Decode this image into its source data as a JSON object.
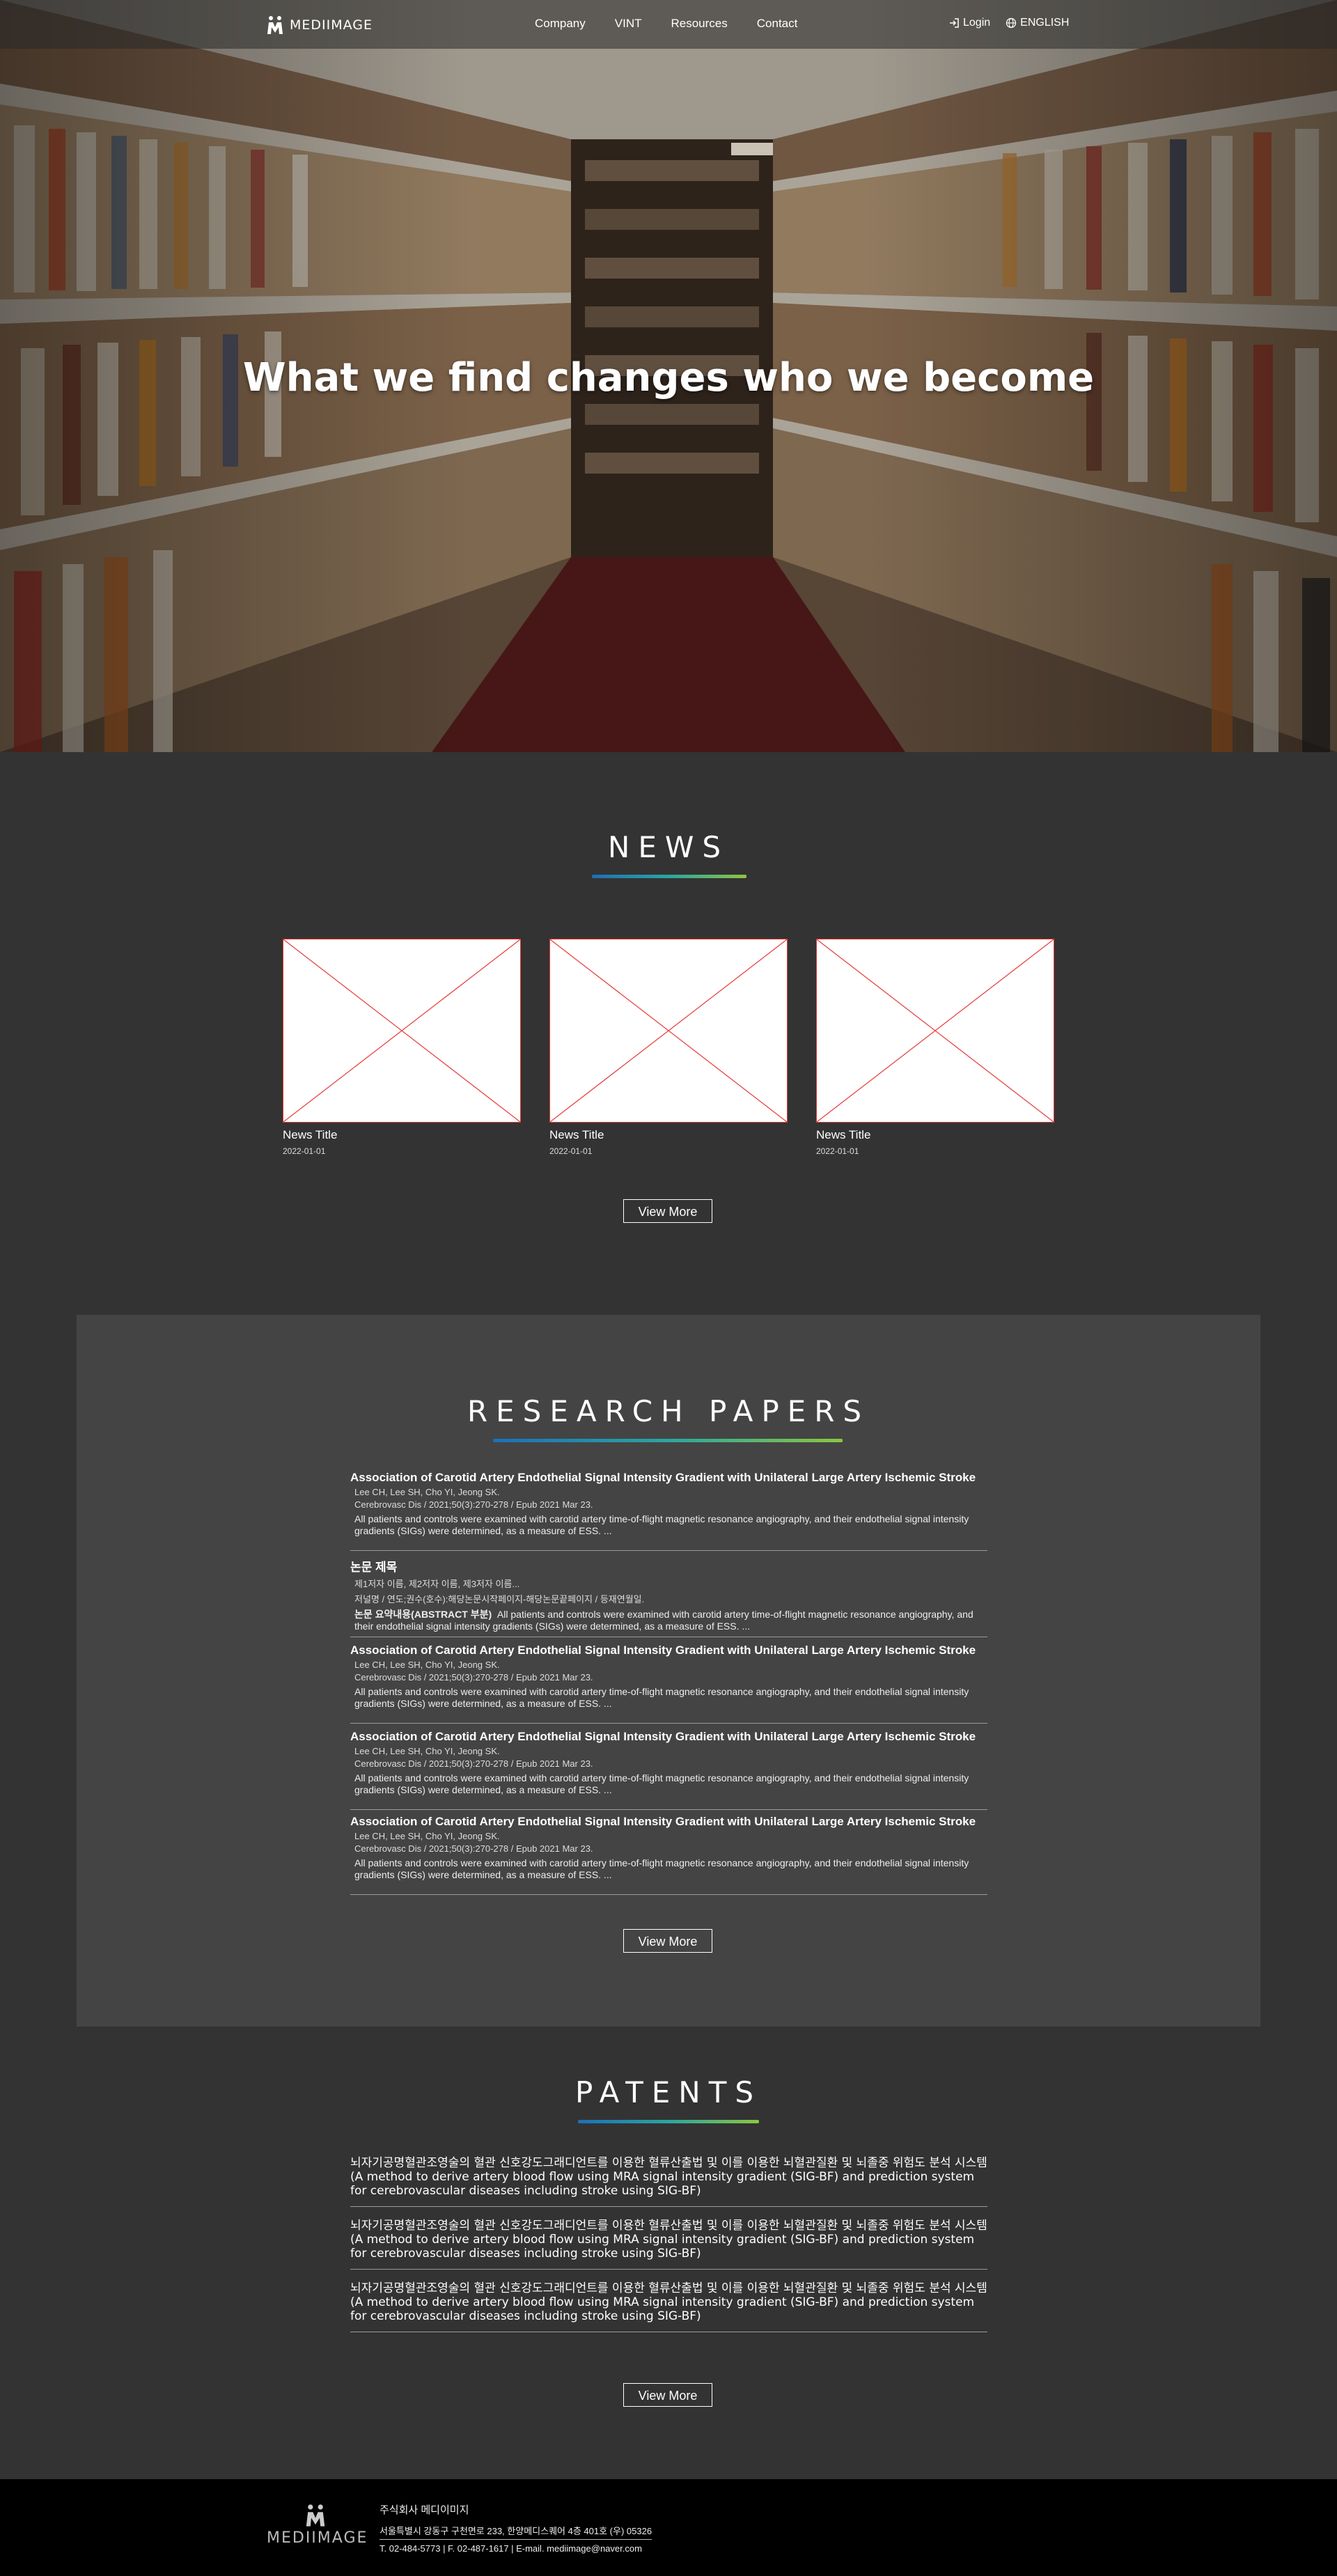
{
  "header": {
    "logo_text": "MEDIIMAGE",
    "nav": [
      "Company",
      "VINT",
      "Resources",
      "Contact"
    ],
    "login": "Login",
    "language": "ENGLISH"
  },
  "hero": {
    "title": "What we find changes who we become"
  },
  "news": {
    "section_title": "NEWS",
    "items": [
      {
        "title": "News Title",
        "date": "2022-01-01"
      },
      {
        "title": "News Title",
        "date": "2022-01-01"
      },
      {
        "title": "News Title",
        "date": "2022-01-01"
      }
    ],
    "view_more": "View More"
  },
  "research": {
    "section_title": "RESEARCH PAPERS",
    "papers": [
      {
        "title": "Association of Carotid Artery Endothelial Signal Intensity Gradient with Unilateral Large Artery Ischemic Stroke",
        "authors": "Lee CH, Lee SH, Cho YI, Jeong SK.",
        "journal": "Cerebrovasc Dis / 2021;50(3):270-278 /  Epub 2021 Mar 23.",
        "abstract_label": "",
        "abstract": "All patients and controls were examined with carotid artery time-of-flight magnetic resonance angiography, and their endothelial signal intensity gradients (SIGs) were determined, as a measure of ESS. ..."
      },
      {
        "title": "논문 제목",
        "authors": "제1저자 이름, 제2저자 이름, 제3저자 이름...",
        "journal": "저널명 / 연도;권수(호수):해당논문시작페이지-해당논문끝페이지 /  등재연월일.",
        "abstract_label": "논문 요약내용(ABSTRACT 부분)",
        "abstract": "All patients and controls were examined with carotid artery time-of-flight magnetic resonance angiography, and their endothelial signal intensity gradients (SIGs) were determined, as a measure of ESS. ..."
      },
      {
        "title": "Association of Carotid Artery Endothelial Signal Intensity Gradient with Unilateral Large Artery Ischemic Stroke",
        "authors": "Lee CH, Lee SH, Cho YI, Jeong SK.",
        "journal": "Cerebrovasc Dis / 2021;50(3):270-278 /  Epub 2021 Mar 23.",
        "abstract_label": "",
        "abstract": "All patients and controls were examined with carotid artery time-of-flight magnetic resonance angiography, and their endothelial signal intensity gradients (SIGs) were determined, as a measure of ESS. ..."
      },
      {
        "title": "Association of Carotid Artery Endothelial Signal Intensity Gradient with Unilateral Large Artery Ischemic Stroke",
        "authors": "Lee CH, Lee SH, Cho YI, Jeong SK.",
        "journal": "Cerebrovasc Dis / 2021;50(3):270-278 /  Epub 2021 Mar 23.",
        "abstract_label": "",
        "abstract": "All patients and controls were examined with carotid artery time-of-flight magnetic resonance angiography, and their endothelial signal intensity gradients (SIGs) were determined, as a measure of ESS. ..."
      },
      {
        "title": "Association of Carotid Artery Endothelial Signal Intensity Gradient with Unilateral Large Artery Ischemic Stroke",
        "authors": "Lee CH, Lee SH, Cho YI, Jeong SK.",
        "journal": "Cerebrovasc Dis / 2021;50(3):270-278 /  Epub 2021 Mar 23.",
        "abstract_label": "",
        "abstract": "All patients and controls were examined with carotid artery time-of-flight magnetic resonance angiography, and their endothelial signal intensity gradients (SIGs) were determined, as a measure of ESS. ..."
      }
    ],
    "view_more": "View More"
  },
  "patents": {
    "section_title": "PATENTS",
    "items": [
      {
        "ko": "뇌자기공명혈관조영술의 혈관 신호강도그래디언트를 이용한 혈류산출법 및 이를 이용한 뇌혈관질환 및 뇌졸중 위험도 분석 시스템",
        "en": "(A method to derive artery blood flow using MRA signal intensity gradient (SIG-BF) and prediction system for cerebrovascular diseases including stroke using SIG-BF)"
      },
      {
        "ko": "뇌자기공명혈관조영술의 혈관 신호강도그래디언트를 이용한 혈류산출법 및 이를 이용한 뇌혈관질환 및 뇌졸중 위험도 분석 시스템",
        "en": "(A method to derive artery blood flow using MRA signal intensity gradient (SIG-BF) and prediction system for cerebrovascular diseases including stroke using SIG-BF)"
      },
      {
        "ko": "뇌자기공명혈관조영술의 혈관 신호강도그래디언트를 이용한 혈류산출법 및 이를 이용한 뇌혈관질환 및 뇌졸중 위험도 분석 시스템",
        "en": "(A method to derive artery blood flow using MRA signal intensity gradient (SIG-BF) and prediction system for cerebrovascular diseases including stroke using SIG-BF)"
      }
    ],
    "view_more": "View More"
  },
  "footer": {
    "logo_text": "MEDIIMAGE",
    "company": "주식회사 메디이미지",
    "address": "서울특별시 강동구 구천면로 233, 한양메디스퀘어 4층 401호 (우) 05326",
    "contact": "T. 02-484-5773  |  F. 02-487-1617  |  E-mail. mediimage@naver.com"
  },
  "colors": {
    "page_bg": "#333333",
    "panel_bg": "#444444",
    "footer_bg": "#000000",
    "accent_blue": "#1d6fb8",
    "accent_green": "#8cc63f",
    "placeholder_border": "#e53935"
  }
}
